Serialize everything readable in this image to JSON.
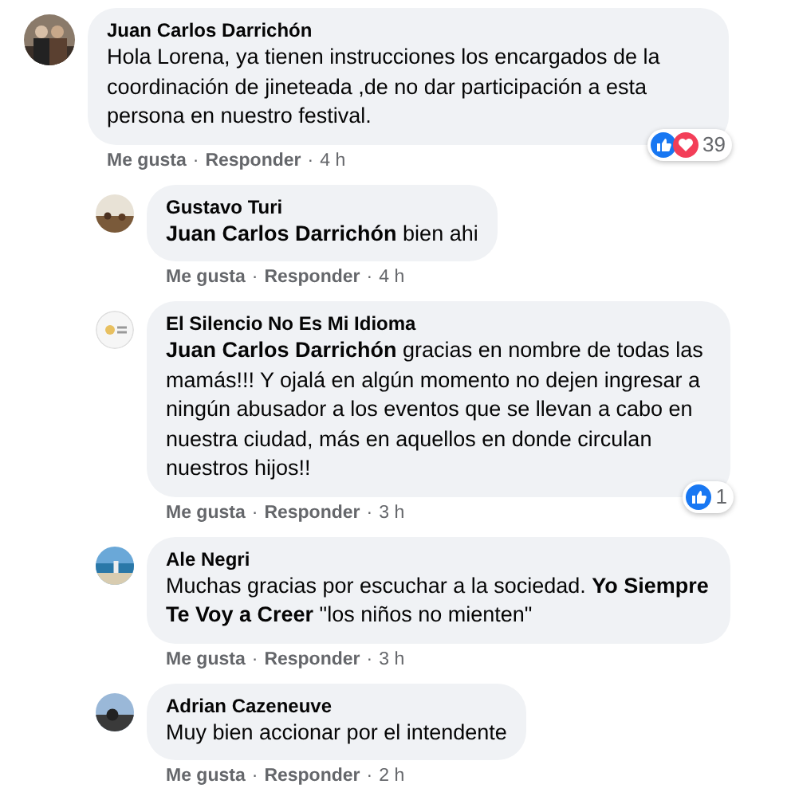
{
  "comments": [
    {
      "author": "Juan Carlos Darrichón",
      "text": "Hola Lorena, ya tienen instrucciones los encargados de la coordinación de jineteada ,de no dar participación a esta persona en nuestro festival.",
      "reply": false,
      "reactions": {
        "icons": [
          {
            "kind": "like"
          },
          {
            "kind": "love"
          }
        ],
        "count": "39"
      },
      "actions": [
        "Me gusta",
        "Responder"
      ],
      "separator": "·",
      "time": "4 h"
    },
    {
      "author": "Gustavo Turi",
      "text": "**Juan Carlos Darrichón** bien ahi",
      "reply": true,
      "actions": [
        "Me gusta",
        "Responder"
      ],
      "separator": "·",
      "time": "4 h"
    },
    {
      "author": "El Silencio No Es Mi Idioma",
      "text": "**Juan Carlos Darrichón** gracias en nombre de todas las mamás!!! Y ojalá en algún momento no dejen ingresar a ningún abusador a los eventos que se llevan a cabo en nuestra ciudad, más en aquellos en donde circulan nuestros hijos!!",
      "reply": true,
      "reactions": {
        "icons": [
          {
            "kind": "like"
          }
        ],
        "count": "1"
      },
      "actions": [
        "Me gusta",
        "Responder"
      ],
      "separator": "·",
      "time": "3 h"
    },
    {
      "author": "Ale Negri",
      "text": "Muchas gracias por escuchar a la sociedad. **Yo Siempre Te Voy a Creer** \"los niños no mienten\"",
      "reply": true,
      "actions": [
        "Me gusta",
        "Responder"
      ],
      "separator": "·",
      "time": "3 h"
    },
    {
      "author": "Adrian Cazeneuve",
      "text": "Muy bien accionar por el intendente",
      "reply": true,
      "actions": [
        "Me gusta",
        "Responder"
      ],
      "separator": "·",
      "time": "2 h"
    }
  ]
}
